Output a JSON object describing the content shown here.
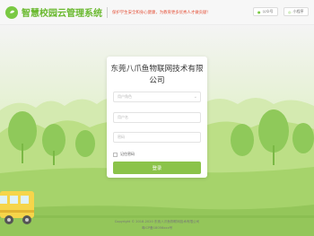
{
  "header": {
    "title": "智慧校园云管理系统",
    "slogan": "保护学生安全和身心健康，为教育更多优秀人才做贡献!",
    "buttons": [
      {
        "label": "公众号"
      },
      {
        "label": "小程序"
      }
    ]
  },
  "login": {
    "company": "东莞八爪鱼物联网技术有限公司",
    "user_type_placeholder": "用户角色",
    "username_placeholder": "用户名",
    "password_placeholder": "密码",
    "remember_label": "记住密码",
    "submit_label": "登录"
  },
  "footer": {
    "copyright": "Copyright © 2018-2020 东莞八爪鱼物联网技术有限公司",
    "icp": "粤ICP备18056xxx号"
  },
  "colors": {
    "brand_green": "#6ab92f",
    "button_green": "#8bc34a",
    "slogan_red": "#e5533b"
  }
}
